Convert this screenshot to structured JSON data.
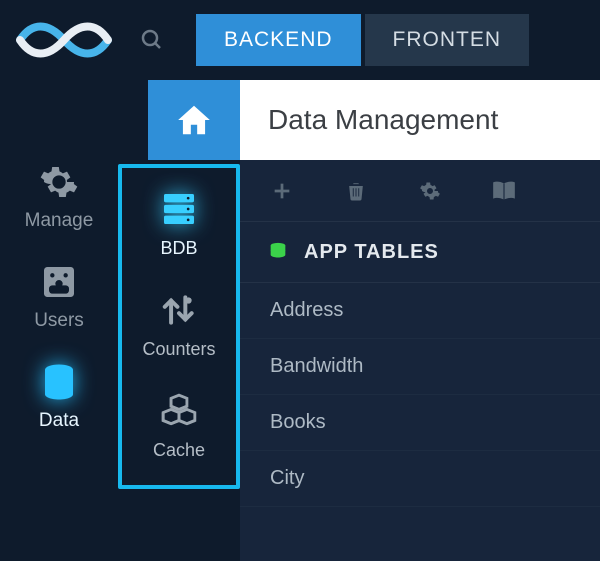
{
  "header": {
    "tabs": {
      "backend": "BACKEND",
      "frontend": "FRONTEN"
    }
  },
  "sidebar1": {
    "manage": "Manage",
    "users": "Users",
    "data": "Data"
  },
  "sidebar2": {
    "bdb": "BDB",
    "counters": "Counters",
    "cache": "Cache"
  },
  "page": {
    "title": "Data Management"
  },
  "section": {
    "title": "APP TABLES"
  },
  "tables": {
    "0": "Address",
    "1": "Bandwidth",
    "2": "Books",
    "3": "City"
  }
}
